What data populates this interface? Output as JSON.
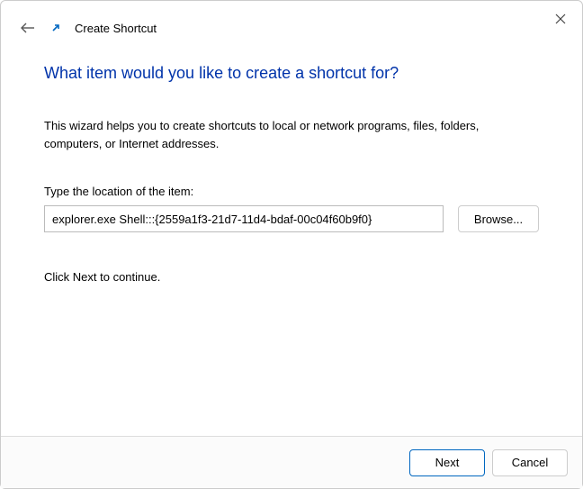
{
  "header": {
    "title": "Create Shortcut"
  },
  "content": {
    "heading": "What item would you like to create a shortcut for?",
    "description": "This wizard helps you to create shortcuts to local or network programs, files, folders, computers, or Internet addresses.",
    "input_label": "Type the location of the item:",
    "input_value": "explorer.exe Shell:::{2559a1f3-21d7-11d4-bdaf-00c04f60b9f0}",
    "browse_label": "Browse...",
    "continue_text": "Click Next to continue."
  },
  "footer": {
    "next_label": "Next",
    "cancel_label": "Cancel"
  }
}
